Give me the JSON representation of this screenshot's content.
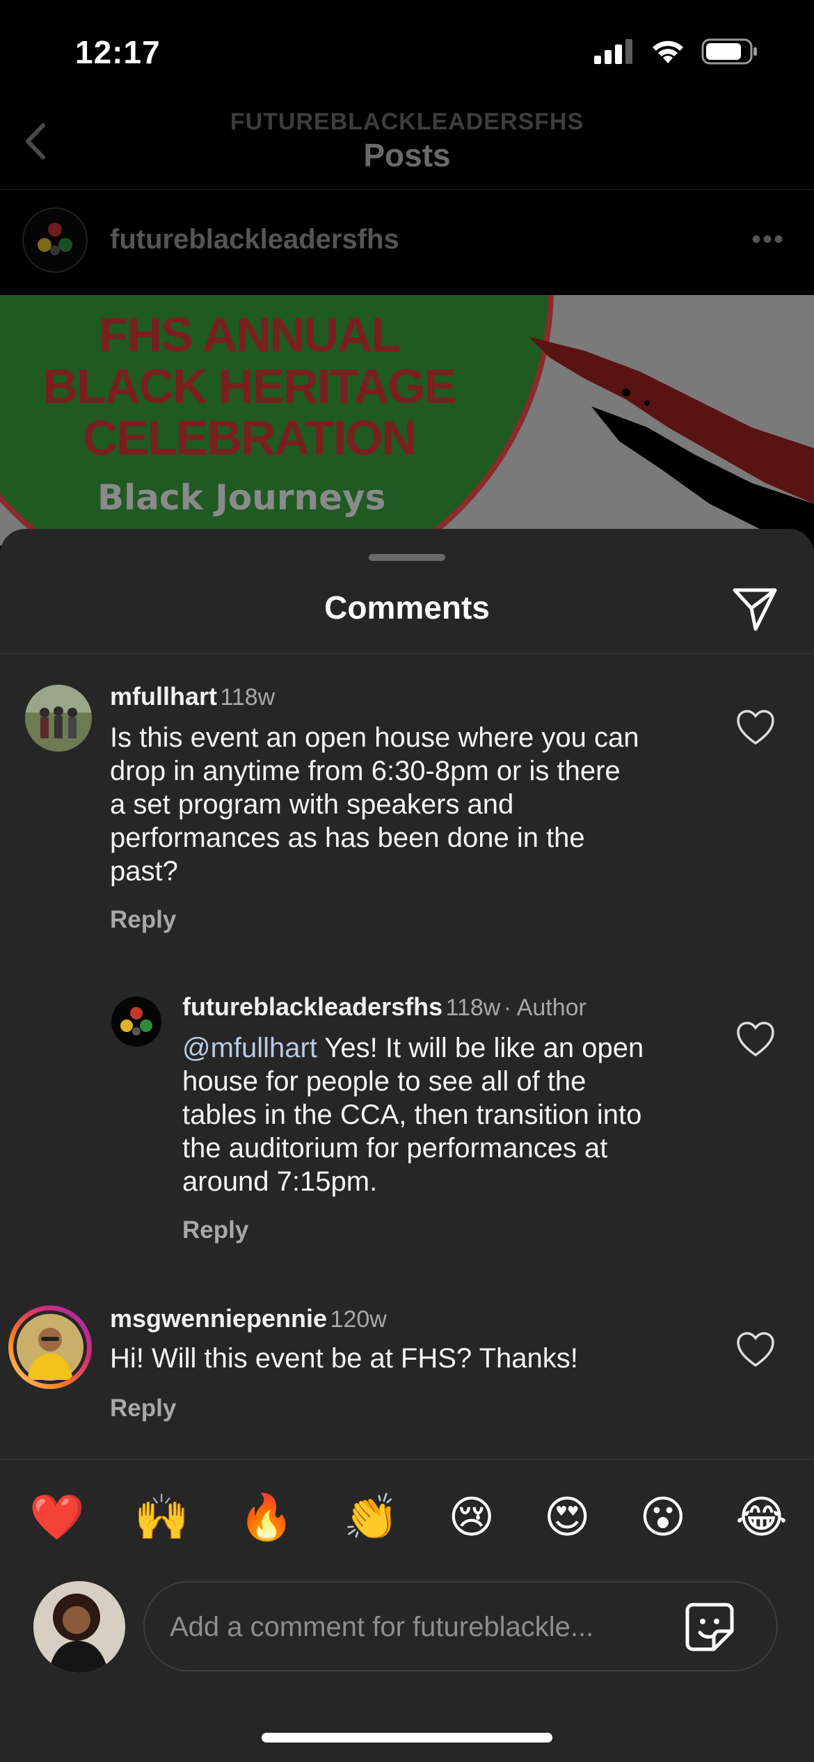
{
  "status_bar": {
    "time": "12:17"
  },
  "header": {
    "username": "FUTUREBLACKLEADERSFHS",
    "title": "Posts"
  },
  "post": {
    "username": "futureblackleadersfhs",
    "more": "•••",
    "image_title": "FHS ANNUAL BLACK HERITAGE CELEBRATION",
    "image_subtitle": "Black Journeys"
  },
  "sheet": {
    "title": "Comments"
  },
  "comments": [
    {
      "username": "mfullhart",
      "time": "118w",
      "text_lines": [
        "Is this event an open house where you can",
        "drop in anytime from 6:30-8pm or is there",
        "a set program with speakers and",
        "performances as has been done in the",
        "past?"
      ],
      "reply": "Reply"
    },
    {
      "username": "futureblackleadersfhs",
      "time": "118w",
      "badge": "· Author",
      "mention": "@mfullhart",
      "text_first": " Yes! It will be like an open",
      "text_lines": [
        "house for people to see all of the",
        "tables in the CCA, then transition into",
        "the auditorium for performances at",
        "around 7:15pm."
      ],
      "reply": "Reply"
    },
    {
      "username": "msgwenniepennie",
      "time": "120w",
      "text_lines": [
        "Hi! Will this event be at FHS? Thanks!"
      ],
      "reply": "Reply"
    }
  ],
  "emoji_reactions": [
    "❤️",
    "🙌",
    "🔥",
    "👏",
    "😢",
    "😍",
    "😮",
    "😂"
  ],
  "composer": {
    "placeholder": "Add a comment for futureblackle..."
  },
  "colors": {
    "sheet_bg": "#262626",
    "mention": "#b8cbe6",
    "story_ring": "#d62976"
  }
}
